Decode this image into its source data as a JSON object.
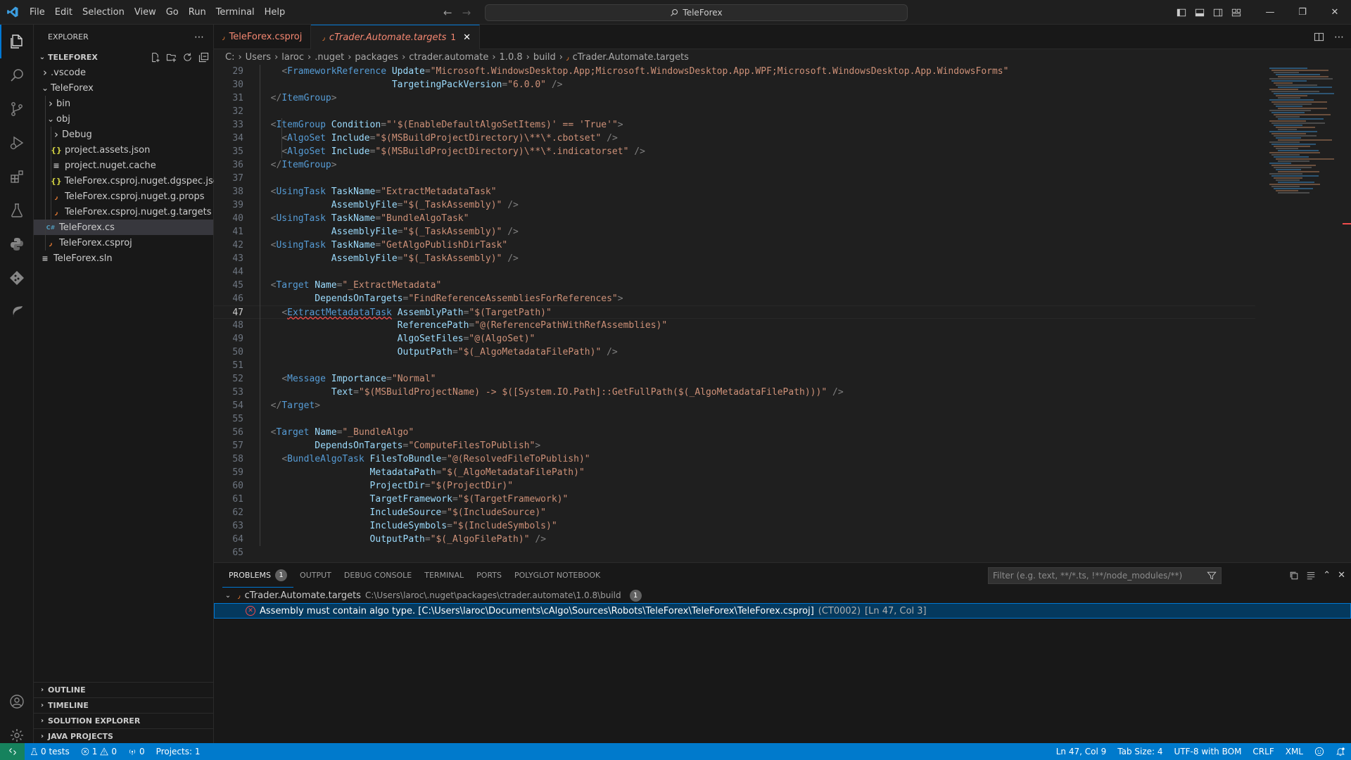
{
  "titlebar": {
    "menus": [
      "File",
      "Edit",
      "Selection",
      "View",
      "Go",
      "Run",
      "Terminal",
      "Help"
    ],
    "search_text": "TeleForex"
  },
  "sidebar": {
    "header": "EXPLORER",
    "section_title": "TELEFOREX",
    "tree": [
      {
        "label": ".vscode",
        "depth": 0,
        "kind": "folder",
        "expanded": false
      },
      {
        "label": "TeleForex",
        "depth": 0,
        "kind": "folder",
        "expanded": true
      },
      {
        "label": "bin",
        "depth": 1,
        "kind": "folder",
        "expanded": false
      },
      {
        "label": "obj",
        "depth": 1,
        "kind": "folder",
        "expanded": true
      },
      {
        "label": "Debug",
        "depth": 2,
        "kind": "folder",
        "expanded": false
      },
      {
        "label": "project.assets.json",
        "depth": 2,
        "kind": "json"
      },
      {
        "label": "project.nuget.cache",
        "depth": 2,
        "kind": "text"
      },
      {
        "label": "TeleForex.csproj.nuget.dgspec.json",
        "depth": 2,
        "kind": "json"
      },
      {
        "label": "TeleForex.csproj.nuget.g.props",
        "depth": 2,
        "kind": "rss"
      },
      {
        "label": "TeleForex.csproj.nuget.g.targets",
        "depth": 2,
        "kind": "rss"
      },
      {
        "label": "TeleForex.cs",
        "depth": 1,
        "kind": "cs",
        "selected": true
      },
      {
        "label": "TeleForex.csproj",
        "depth": 1,
        "kind": "rss"
      },
      {
        "label": "TeleForex.sln",
        "depth": 0,
        "kind": "text"
      }
    ],
    "panels": [
      "OUTLINE",
      "TIMELINE",
      "SOLUTION EXPLORER",
      "JAVA PROJECTS"
    ]
  },
  "tabs": [
    {
      "label": "TeleForex.csproj",
      "active": false
    },
    {
      "label": "cTrader.Automate.targets",
      "badge": "1",
      "active": true
    }
  ],
  "breadcrumbs": [
    "C:",
    "Users",
    "laroc",
    ".nuget",
    "packages",
    "ctrader.automate",
    "1.0.8",
    "build",
    "cTrader.Automate.targets"
  ],
  "editor": {
    "current_line": 47,
    "lines": [
      {
        "n": 29,
        "tokens": [
          [
            "p",
            "    "
          ],
          [
            "u",
            "<"
          ],
          [
            "t",
            "FrameworkReference"
          ],
          [
            "p",
            " "
          ],
          [
            "a",
            "Update"
          ],
          [
            "u",
            "="
          ],
          [
            "s",
            "\"Microsoft.WindowsDesktop.App;Microsoft.WindowsDesktop.App.WPF;Microsoft.WindowsDesktop.App.WindowsForms\""
          ]
        ]
      },
      {
        "n": 30,
        "tokens": [
          [
            "p",
            "                        "
          ],
          [
            "a",
            "TargetingPackVersion"
          ],
          [
            "u",
            "="
          ],
          [
            "s",
            "\"6.0.0\""
          ],
          [
            "p",
            " "
          ],
          [
            "u",
            "/>"
          ]
        ]
      },
      {
        "n": 31,
        "tokens": [
          [
            "p",
            "  "
          ],
          [
            "u",
            "</"
          ],
          [
            "t",
            "ItemGroup"
          ],
          [
            "u",
            ">"
          ]
        ]
      },
      {
        "n": 32,
        "tokens": []
      },
      {
        "n": 33,
        "tokens": [
          [
            "p",
            "  "
          ],
          [
            "u",
            "<"
          ],
          [
            "t",
            "ItemGroup"
          ],
          [
            "p",
            " "
          ],
          [
            "a",
            "Condition"
          ],
          [
            "u",
            "="
          ],
          [
            "s",
            "\"'$(EnableDefaultAlgoSetItems)' == 'True'\""
          ],
          [
            "u",
            ">"
          ]
        ]
      },
      {
        "n": 34,
        "tokens": [
          [
            "p",
            "    "
          ],
          [
            "u",
            "<"
          ],
          [
            "t",
            "AlgoSet"
          ],
          [
            "p",
            " "
          ],
          [
            "a",
            "Include"
          ],
          [
            "u",
            "="
          ],
          [
            "s",
            "\"$(MSBuildProjectDirectory)\\**\\*.cbotset\""
          ],
          [
            "p",
            " "
          ],
          [
            "u",
            "/>"
          ]
        ]
      },
      {
        "n": 35,
        "tokens": [
          [
            "p",
            "    "
          ],
          [
            "u",
            "<"
          ],
          [
            "t",
            "AlgoSet"
          ],
          [
            "p",
            " "
          ],
          [
            "a",
            "Include"
          ],
          [
            "u",
            "="
          ],
          [
            "s",
            "\"$(MSBuildProjectDirectory)\\**\\*.indicatorset\""
          ],
          [
            "p",
            " "
          ],
          [
            "u",
            "/>"
          ]
        ]
      },
      {
        "n": 36,
        "tokens": [
          [
            "p",
            "  "
          ],
          [
            "u",
            "</"
          ],
          [
            "t",
            "ItemGroup"
          ],
          [
            "u",
            ">"
          ]
        ]
      },
      {
        "n": 37,
        "tokens": []
      },
      {
        "n": 38,
        "tokens": [
          [
            "p",
            "  "
          ],
          [
            "u",
            "<"
          ],
          [
            "t",
            "UsingTask"
          ],
          [
            "p",
            " "
          ],
          [
            "a",
            "TaskName"
          ],
          [
            "u",
            "="
          ],
          [
            "s",
            "\"ExtractMetadataTask\""
          ]
        ]
      },
      {
        "n": 39,
        "tokens": [
          [
            "p",
            "             "
          ],
          [
            "a",
            "AssemblyFile"
          ],
          [
            "u",
            "="
          ],
          [
            "s",
            "\"$(_TaskAssembly)\""
          ],
          [
            "p",
            " "
          ],
          [
            "u",
            "/>"
          ]
        ]
      },
      {
        "n": 40,
        "tokens": [
          [
            "p",
            "  "
          ],
          [
            "u",
            "<"
          ],
          [
            "t",
            "UsingTask"
          ],
          [
            "p",
            " "
          ],
          [
            "a",
            "TaskName"
          ],
          [
            "u",
            "="
          ],
          [
            "s",
            "\"BundleAlgoTask\""
          ]
        ]
      },
      {
        "n": 41,
        "tokens": [
          [
            "p",
            "             "
          ],
          [
            "a",
            "AssemblyFile"
          ],
          [
            "u",
            "="
          ],
          [
            "s",
            "\"$(_TaskAssembly)\""
          ],
          [
            "p",
            " "
          ],
          [
            "u",
            "/>"
          ]
        ]
      },
      {
        "n": 42,
        "tokens": [
          [
            "p",
            "  "
          ],
          [
            "u",
            "<"
          ],
          [
            "t",
            "UsingTask"
          ],
          [
            "p",
            " "
          ],
          [
            "a",
            "TaskName"
          ],
          [
            "u",
            "="
          ],
          [
            "s",
            "\"GetAlgoPublishDirTask\""
          ]
        ]
      },
      {
        "n": 43,
        "tokens": [
          [
            "p",
            "             "
          ],
          [
            "a",
            "AssemblyFile"
          ],
          [
            "u",
            "="
          ],
          [
            "s",
            "\"$(_TaskAssembly)\""
          ],
          [
            "p",
            " "
          ],
          [
            "u",
            "/>"
          ]
        ]
      },
      {
        "n": 44,
        "tokens": []
      },
      {
        "n": 45,
        "tokens": [
          [
            "p",
            "  "
          ],
          [
            "u",
            "<"
          ],
          [
            "t",
            "Target"
          ],
          [
            "p",
            " "
          ],
          [
            "a",
            "Name"
          ],
          [
            "u",
            "="
          ],
          [
            "s",
            "\"_ExtractMetadata\""
          ]
        ]
      },
      {
        "n": 46,
        "tokens": [
          [
            "p",
            "          "
          ],
          [
            "a",
            "DependsOnTargets"
          ],
          [
            "u",
            "="
          ],
          [
            "s",
            "\"FindReferenceAssembliesForReferences\""
          ],
          [
            "u",
            ">"
          ]
        ]
      },
      {
        "n": 47,
        "tokens": [
          [
            "p",
            "    "
          ],
          [
            "u",
            "<"
          ],
          [
            "t",
            "ExtractMetadataTask"
          ],
          [
            "p",
            " "
          ],
          [
            "a",
            "AssemblyPath"
          ],
          [
            "u",
            "="
          ],
          [
            "s",
            "\"$(TargetPath)\""
          ]
        ]
      },
      {
        "n": 48,
        "tokens": [
          [
            "p",
            "                         "
          ],
          [
            "a",
            "ReferencePath"
          ],
          [
            "u",
            "="
          ],
          [
            "s",
            "\"@(ReferencePathWithRefAssemblies)\""
          ]
        ]
      },
      {
        "n": 49,
        "tokens": [
          [
            "p",
            "                         "
          ],
          [
            "a",
            "AlgoSetFiles"
          ],
          [
            "u",
            "="
          ],
          [
            "s",
            "\"@(AlgoSet)\""
          ]
        ]
      },
      {
        "n": 50,
        "tokens": [
          [
            "p",
            "                         "
          ],
          [
            "a",
            "OutputPath"
          ],
          [
            "u",
            "="
          ],
          [
            "s",
            "\"$(_AlgoMetadataFilePath)\""
          ],
          [
            "p",
            " "
          ],
          [
            "u",
            "/>"
          ]
        ]
      },
      {
        "n": 51,
        "tokens": []
      },
      {
        "n": 52,
        "tokens": [
          [
            "p",
            "    "
          ],
          [
            "u",
            "<"
          ],
          [
            "t",
            "Message"
          ],
          [
            "p",
            " "
          ],
          [
            "a",
            "Importance"
          ],
          [
            "u",
            "="
          ],
          [
            "s",
            "\"Normal\""
          ]
        ]
      },
      {
        "n": 53,
        "tokens": [
          [
            "p",
            "             "
          ],
          [
            "a",
            "Text"
          ],
          [
            "u",
            "="
          ],
          [
            "s",
            "\"$(MSBuildProjectName) -> $([System.IO.Path]::GetFullPath($(_AlgoMetadataFilePath)))\""
          ],
          [
            "p",
            " "
          ],
          [
            "u",
            "/>"
          ]
        ]
      },
      {
        "n": 54,
        "tokens": [
          [
            "p",
            "  "
          ],
          [
            "u",
            "</"
          ],
          [
            "t",
            "Target"
          ],
          [
            "u",
            ">"
          ]
        ]
      },
      {
        "n": 55,
        "tokens": []
      },
      {
        "n": 56,
        "tokens": [
          [
            "p",
            "  "
          ],
          [
            "u",
            "<"
          ],
          [
            "t",
            "Target"
          ],
          [
            "p",
            " "
          ],
          [
            "a",
            "Name"
          ],
          [
            "u",
            "="
          ],
          [
            "s",
            "\"_BundleAlgo\""
          ]
        ]
      },
      {
        "n": 57,
        "tokens": [
          [
            "p",
            "          "
          ],
          [
            "a",
            "DependsOnTargets"
          ],
          [
            "u",
            "="
          ],
          [
            "s",
            "\"ComputeFilesToPublish\""
          ],
          [
            "u",
            ">"
          ]
        ]
      },
      {
        "n": 58,
        "tokens": [
          [
            "p",
            "    "
          ],
          [
            "u",
            "<"
          ],
          [
            "t",
            "BundleAlgoTask"
          ],
          [
            "p",
            " "
          ],
          [
            "a",
            "FilesToBundle"
          ],
          [
            "u",
            "="
          ],
          [
            "s",
            "\"@(ResolvedFileToPublish)\""
          ]
        ]
      },
      {
        "n": 59,
        "tokens": [
          [
            "p",
            "                    "
          ],
          [
            "a",
            "MetadataPath"
          ],
          [
            "u",
            "="
          ],
          [
            "s",
            "\"$(_AlgoMetadataFilePath)\""
          ]
        ]
      },
      {
        "n": 60,
        "tokens": [
          [
            "p",
            "                    "
          ],
          [
            "a",
            "ProjectDir"
          ],
          [
            "u",
            "="
          ],
          [
            "s",
            "\"$(ProjectDir)\""
          ]
        ]
      },
      {
        "n": 61,
        "tokens": [
          [
            "p",
            "                    "
          ],
          [
            "a",
            "TargetFramework"
          ],
          [
            "u",
            "="
          ],
          [
            "s",
            "\"$(TargetFramework)\""
          ]
        ]
      },
      {
        "n": 62,
        "tokens": [
          [
            "p",
            "                    "
          ],
          [
            "a",
            "IncludeSource"
          ],
          [
            "u",
            "="
          ],
          [
            "s",
            "\"$(IncludeSource)\""
          ]
        ]
      },
      {
        "n": 63,
        "tokens": [
          [
            "p",
            "                    "
          ],
          [
            "a",
            "IncludeSymbols"
          ],
          [
            "u",
            "="
          ],
          [
            "s",
            "\"$(IncludeSymbols)\""
          ]
        ]
      },
      {
        "n": 64,
        "tokens": [
          [
            "p",
            "                    "
          ],
          [
            "a",
            "OutputPath"
          ],
          [
            "u",
            "="
          ],
          [
            "s",
            "\"$(_AlgoFilePath)\""
          ],
          [
            "p",
            " "
          ],
          [
            "u",
            "/>"
          ]
        ]
      },
      {
        "n": 65,
        "tokens": []
      }
    ]
  },
  "panel": {
    "tabs": [
      {
        "label": "PROBLEMS",
        "badge": "1",
        "active": true
      },
      {
        "label": "OUTPUT"
      },
      {
        "label": "DEBUG CONSOLE"
      },
      {
        "label": "TERMINAL"
      },
      {
        "label": "PORTS"
      },
      {
        "label": "POLYGLOT NOTEBOOK"
      }
    ],
    "filter_placeholder": "Filter (e.g. text, **/*.ts, !**/node_modules/**)",
    "problem_file": {
      "name": "cTrader.Automate.targets",
      "path": "C:\\Users\\laroc\\.nuget\\packages\\ctrader.automate\\1.0.8\\build",
      "count": "1"
    },
    "problem_item": {
      "message": "Assembly must contain algo type. [C:\\Users\\laroc\\Documents\\cAlgo\\Sources\\Robots\\TeleForex\\TeleForex\\TeleForex.csproj]",
      "code": "(CT0002)",
      "location": "[Ln 47, Col 3]"
    }
  },
  "statusbar": {
    "tests": "0 tests",
    "errors": "1",
    "warnings": "0",
    "ports": "0",
    "projects": "Projects: 1",
    "position": "Ln 47, Col 9",
    "tab_size": "Tab Size: 4",
    "encoding": "UTF-8 with BOM",
    "eol": "CRLF",
    "language": "XML"
  },
  "colors": {
    "accent": "#0078d4",
    "statusbar": "#007acc",
    "error": "#f14c4c",
    "xml_tag": "#569cd6",
    "xml_attr": "#9cdcfe",
    "xml_string": "#ce9178"
  }
}
